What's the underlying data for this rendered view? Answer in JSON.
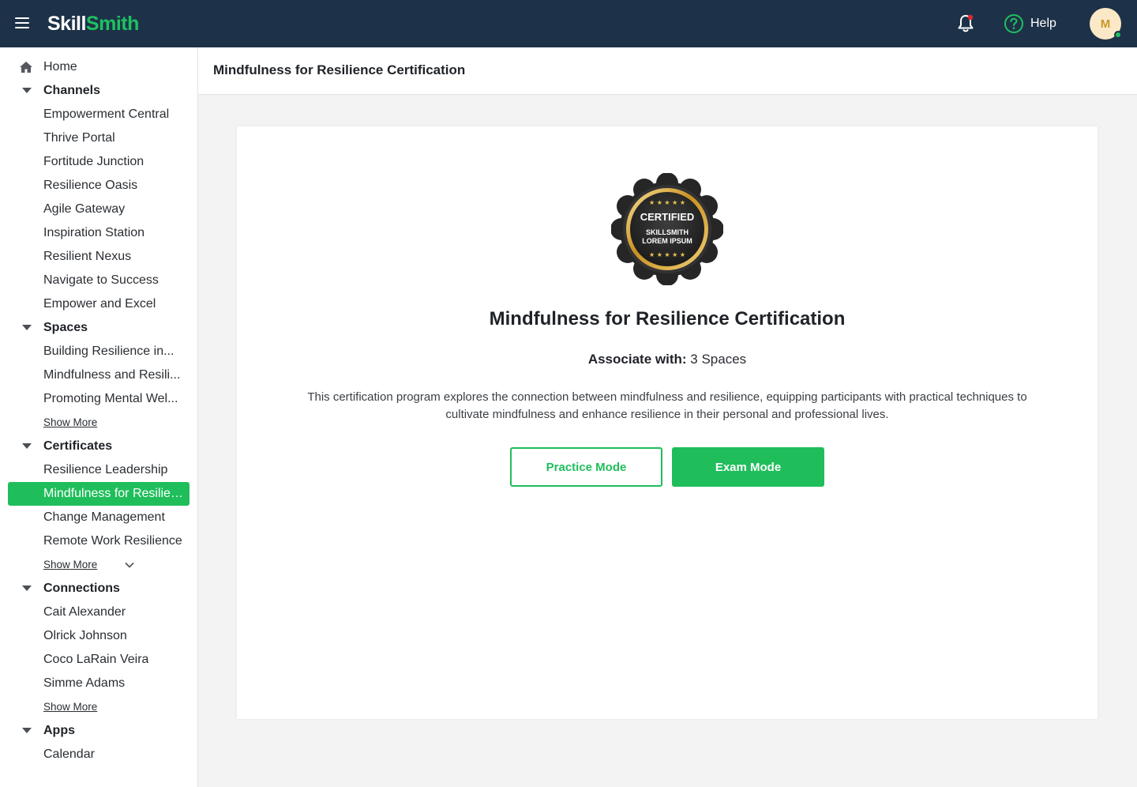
{
  "app": {
    "logo_part1": "Skill",
    "logo_part2": "Smith",
    "help_label": "Help",
    "avatar_initial": "M",
    "brand_color": "#1fbe5b",
    "topbar_color": "#1d3248"
  },
  "sidebar": {
    "home": "Home",
    "channels": {
      "label": "Channels",
      "items": [
        "Empowerment Central",
        "Thrive Portal",
        "Fortitude Junction",
        "Resilience Oasis",
        "Agile Gateway",
        "Inspiration Station",
        "Resilient Nexus",
        "Navigate to Success",
        "Empower and Excel"
      ]
    },
    "spaces": {
      "label": "Spaces",
      "items": [
        "Building Resilience in...",
        "Mindfulness and Resili...",
        "Promoting Mental Wel..."
      ],
      "show_more": "Show More"
    },
    "certificates": {
      "label": "Certificates",
      "items": [
        "Resilience Leadership",
        "Mindfulness for Resilien...",
        "Change Management",
        "Remote Work Resilience"
      ],
      "active_index": 1,
      "show_more": "Show More"
    },
    "connections": {
      "label": "Connections",
      "items": [
        "Cait Alexander",
        "Olrick Johnson",
        "Coco LaRain Veira",
        "Simme Adams"
      ],
      "show_more": "Show More"
    },
    "apps": {
      "label": "Apps",
      "items": [
        "Calendar"
      ]
    }
  },
  "main": {
    "page_title": "Mindfulness for Resilience Certification",
    "badge": {
      "line1": "CERTIFIED",
      "line2": "SKILLSMITH",
      "line3": "LOREM IPSUM"
    },
    "cert_title": "Mindfulness for Resilience Certification",
    "associate_label": "Associate with:",
    "associate_value": "3 Spaces",
    "description": "This certification program explores the connection between mindfulness and resilience, equipping participants with practical techniques to cultivate mindfulness and enhance resilience in their personal and professional lives.",
    "practice_label": "Practice Mode",
    "exam_label": "Exam Mode"
  }
}
